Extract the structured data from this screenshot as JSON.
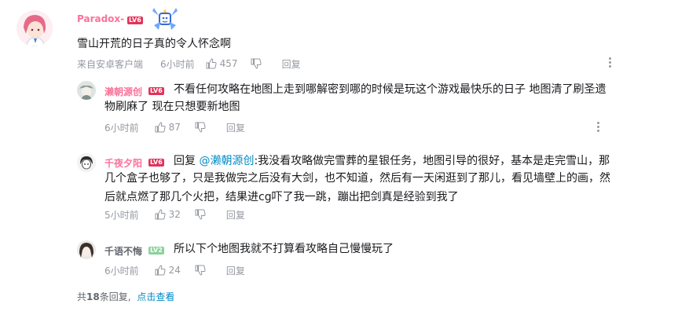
{
  "root_comment": {
    "username": "Paradox-",
    "level": "LV6",
    "text": "雪山开荒的日子真的令人怀念啊",
    "source": "来自安卓客户端",
    "time": "6小时前",
    "likes": "457",
    "reply_label": "回复",
    "name_color": "#fb7299"
  },
  "replies": [
    {
      "username": "濑朝源创",
      "level": "LV6",
      "name_color": "#fb7299",
      "text_line1": "不看任何攻略在地图上走到哪解密到哪的时候是玩这个游戏最快乐的日子 地图清了刷圣遗",
      "text_line2": "物刷麻了 现在只想要新地图",
      "time": "6小时前",
      "likes": "87",
      "reply_label": "回复"
    },
    {
      "username": "千夜夕阳",
      "level": "LV6",
      "name_color": "#fb7299",
      "reply_prefix": "回复",
      "mention": "@濑朝源创",
      "text_line1": ":我没看攻略做完雪葬的星银任务，地图引导的很好，基本是走完雪山，那",
      "text_line2": "几个盒子也够了，只是我做完之后没有大剑，也不知道，然后有一天闲逛到了那儿，看见墙壁上的画，然",
      "text_line3": "后就点燃了那几个火把，结果进cg吓了我一跳，蹦出把剑真是经验到我了",
      "time": "5小时前",
      "likes": "32",
      "reply_label": "回复"
    },
    {
      "username": "千语不悔",
      "level": "LV2",
      "name_color": "#61666d",
      "text_line1": "所以下个地图我就不打算看攻略自己慢慢玩了",
      "time": "6小时前",
      "likes": "24",
      "reply_label": "回复"
    }
  ],
  "footer": {
    "prefix": "共",
    "count": "18",
    "suffix": "条回复,",
    "view_more": "点击查看"
  }
}
